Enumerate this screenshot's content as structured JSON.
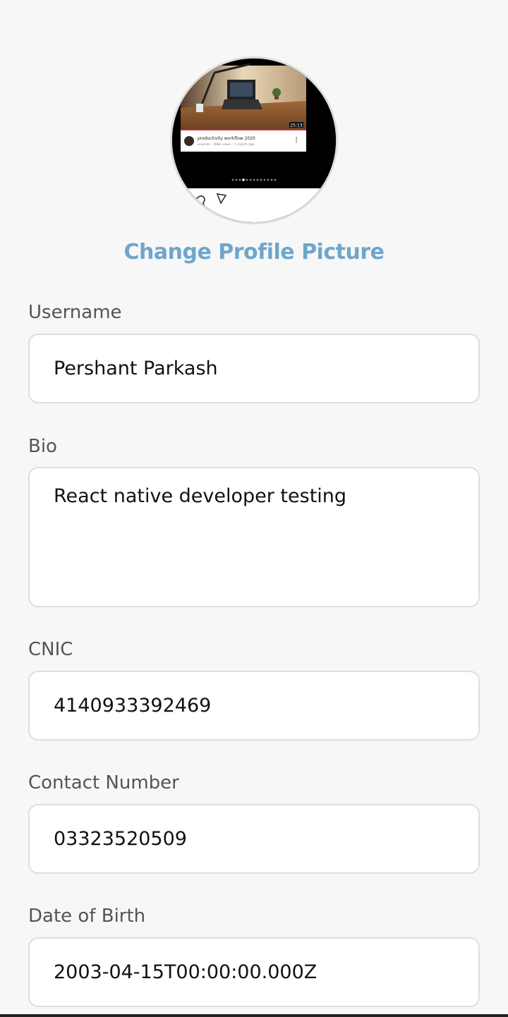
{
  "profile": {
    "change_picture_label": "Change Profile Picture",
    "photo_caption_title": "productivity workflow 2020",
    "photo_caption_meta": "pearsdc · 498k views · 1 month ago",
    "photo_timestamp": "25:13"
  },
  "form": {
    "fields": [
      {
        "label": "Username",
        "value": "Pershant Parkash"
      },
      {
        "label": "Bio",
        "value": "React native developer testing"
      },
      {
        "label": "CNIC",
        "value": "4140933392469"
      },
      {
        "label": "Contact Number",
        "value": "03323520509"
      },
      {
        "label": "Date of Birth",
        "value": "2003-04-15T00:00:00.000Z"
      }
    ]
  },
  "colors": {
    "background": "#f7f7f7",
    "link": "#6ea6cc",
    "input_border": "#dedede"
  }
}
